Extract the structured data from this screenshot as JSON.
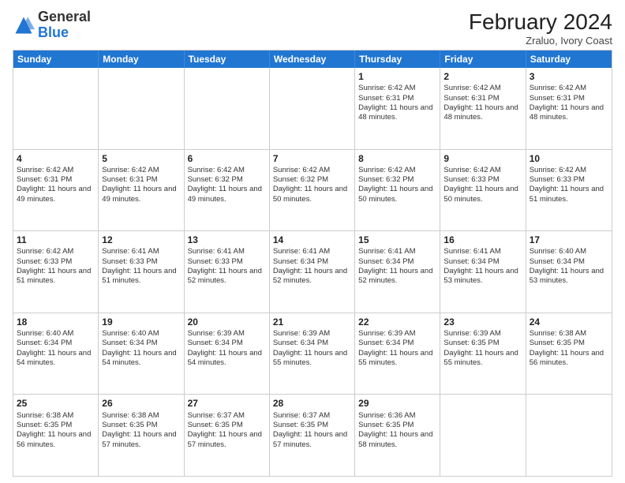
{
  "header": {
    "logo_general": "General",
    "logo_blue": "Blue",
    "month_year": "February 2024",
    "location": "Zraluo, Ivory Coast"
  },
  "days_of_week": [
    "Sunday",
    "Monday",
    "Tuesday",
    "Wednesday",
    "Thursday",
    "Friday",
    "Saturday"
  ],
  "weeks": [
    [
      {
        "day": "",
        "info": ""
      },
      {
        "day": "",
        "info": ""
      },
      {
        "day": "",
        "info": ""
      },
      {
        "day": "",
        "info": ""
      },
      {
        "day": "1",
        "info": "Sunrise: 6:42 AM\nSunset: 6:31 PM\nDaylight: 11 hours and 48 minutes."
      },
      {
        "day": "2",
        "info": "Sunrise: 6:42 AM\nSunset: 6:31 PM\nDaylight: 11 hours and 48 minutes."
      },
      {
        "day": "3",
        "info": "Sunrise: 6:42 AM\nSunset: 6:31 PM\nDaylight: 11 hours and 48 minutes."
      }
    ],
    [
      {
        "day": "4",
        "info": "Sunrise: 6:42 AM\nSunset: 6:31 PM\nDaylight: 11 hours and 49 minutes."
      },
      {
        "day": "5",
        "info": "Sunrise: 6:42 AM\nSunset: 6:31 PM\nDaylight: 11 hours and 49 minutes."
      },
      {
        "day": "6",
        "info": "Sunrise: 6:42 AM\nSunset: 6:32 PM\nDaylight: 11 hours and 49 minutes."
      },
      {
        "day": "7",
        "info": "Sunrise: 6:42 AM\nSunset: 6:32 PM\nDaylight: 11 hours and 50 minutes."
      },
      {
        "day": "8",
        "info": "Sunrise: 6:42 AM\nSunset: 6:32 PM\nDaylight: 11 hours and 50 minutes."
      },
      {
        "day": "9",
        "info": "Sunrise: 6:42 AM\nSunset: 6:33 PM\nDaylight: 11 hours and 50 minutes."
      },
      {
        "day": "10",
        "info": "Sunrise: 6:42 AM\nSunset: 6:33 PM\nDaylight: 11 hours and 51 minutes."
      }
    ],
    [
      {
        "day": "11",
        "info": "Sunrise: 6:42 AM\nSunset: 6:33 PM\nDaylight: 11 hours and 51 minutes."
      },
      {
        "day": "12",
        "info": "Sunrise: 6:41 AM\nSunset: 6:33 PM\nDaylight: 11 hours and 51 minutes."
      },
      {
        "day": "13",
        "info": "Sunrise: 6:41 AM\nSunset: 6:33 PM\nDaylight: 11 hours and 52 minutes."
      },
      {
        "day": "14",
        "info": "Sunrise: 6:41 AM\nSunset: 6:34 PM\nDaylight: 11 hours and 52 minutes."
      },
      {
        "day": "15",
        "info": "Sunrise: 6:41 AM\nSunset: 6:34 PM\nDaylight: 11 hours and 52 minutes."
      },
      {
        "day": "16",
        "info": "Sunrise: 6:41 AM\nSunset: 6:34 PM\nDaylight: 11 hours and 53 minutes."
      },
      {
        "day": "17",
        "info": "Sunrise: 6:40 AM\nSunset: 6:34 PM\nDaylight: 11 hours and 53 minutes."
      }
    ],
    [
      {
        "day": "18",
        "info": "Sunrise: 6:40 AM\nSunset: 6:34 PM\nDaylight: 11 hours and 54 minutes."
      },
      {
        "day": "19",
        "info": "Sunrise: 6:40 AM\nSunset: 6:34 PM\nDaylight: 11 hours and 54 minutes."
      },
      {
        "day": "20",
        "info": "Sunrise: 6:39 AM\nSunset: 6:34 PM\nDaylight: 11 hours and 54 minutes."
      },
      {
        "day": "21",
        "info": "Sunrise: 6:39 AM\nSunset: 6:34 PM\nDaylight: 11 hours and 55 minutes."
      },
      {
        "day": "22",
        "info": "Sunrise: 6:39 AM\nSunset: 6:34 PM\nDaylight: 11 hours and 55 minutes."
      },
      {
        "day": "23",
        "info": "Sunrise: 6:39 AM\nSunset: 6:35 PM\nDaylight: 11 hours and 55 minutes."
      },
      {
        "day": "24",
        "info": "Sunrise: 6:38 AM\nSunset: 6:35 PM\nDaylight: 11 hours and 56 minutes."
      }
    ],
    [
      {
        "day": "25",
        "info": "Sunrise: 6:38 AM\nSunset: 6:35 PM\nDaylight: 11 hours and 56 minutes."
      },
      {
        "day": "26",
        "info": "Sunrise: 6:38 AM\nSunset: 6:35 PM\nDaylight: 11 hours and 57 minutes."
      },
      {
        "day": "27",
        "info": "Sunrise: 6:37 AM\nSunset: 6:35 PM\nDaylight: 11 hours and 57 minutes."
      },
      {
        "day": "28",
        "info": "Sunrise: 6:37 AM\nSunset: 6:35 PM\nDaylight: 11 hours and 57 minutes."
      },
      {
        "day": "29",
        "info": "Sunrise: 6:36 AM\nSunset: 6:35 PM\nDaylight: 11 hours and 58 minutes."
      },
      {
        "day": "",
        "info": ""
      },
      {
        "day": "",
        "info": ""
      }
    ]
  ]
}
